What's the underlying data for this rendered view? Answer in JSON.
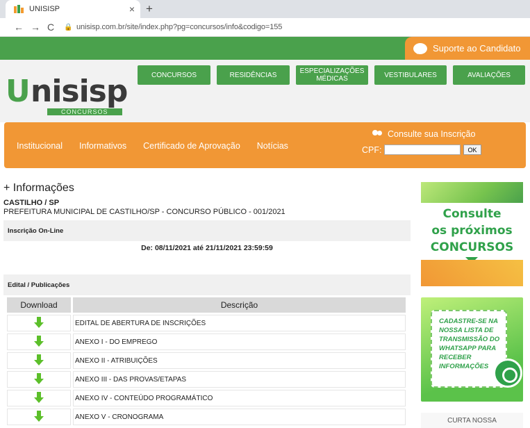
{
  "browser": {
    "tab_title": "UNISISP",
    "tab_close": "×",
    "new_tab": "+",
    "back": "←",
    "forward": "→",
    "reload": "C",
    "url": "unisisp.com.br/site/index.php?pg=concursos/info&codigo=155"
  },
  "topbar": {
    "support_label": "Suporte ao Candidato"
  },
  "logo": {
    "initial": "U",
    "name": "nisisp",
    "subtitle": "CONCURSOS"
  },
  "nav": {
    "concursos": "CONCURSOS",
    "residencias": "RESIDÊNCIAS",
    "especializacoes_1": "ESPECIALIZAÇÕES",
    "especializacoes_2": "MÉDICAS",
    "vestibulares": "VESTIBULARES",
    "avaliacoes": "AVALIAÇÕES"
  },
  "menu": {
    "institucional": "Institucional",
    "informativos": "Informativos",
    "certificado": "Certificado de Aprovação",
    "noticias": "Notícias"
  },
  "consulte": {
    "title": "Consulte sua Inscrição",
    "cpf_label": "CPF:",
    "ok": "OK"
  },
  "main": {
    "heading": "+ Informações",
    "city": "CASTILHO / SP",
    "title": "PREFEITURA MUNICIPAL DE CASTILHO/SP - CONCURSO PÚBLICO - 001/2021",
    "inscricao_header": "Inscrição On-Line",
    "dates": "De: 08/11/2021 até 21/11/2021 23:59:59",
    "edital_header": "Edital / Publicações",
    "table_headers": [
      "Download",
      "Descrição"
    ],
    "rows": [
      "EDITAL DE ABERTURA DE INSCRIÇÕES",
      "ANEXO I - DO EMPREGO",
      "ANEXO II - ATRIBUIÇÕES",
      "ANEXO III - DAS PROVAS/ETAPAS",
      "ANEXO IV - CONTEÚDO PROGRAMÁTICO",
      "ANEXO V - CRONOGRAMA"
    ]
  },
  "side": {
    "consulte_1": "Consulte",
    "consulte_2": "os próximos",
    "consulte_3": "CONCURSOS",
    "wa_1": "CADASTRE-SE NA",
    "wa_2": "NOSSA LISTA DE",
    "wa_3": "TRANSMISSÃO DO",
    "wa_4": "WHATSAPP PARA",
    "wa_5": "RECEBER",
    "wa_6": "INFORMAÇÕES",
    "curta": "CURTA NOSSA"
  }
}
